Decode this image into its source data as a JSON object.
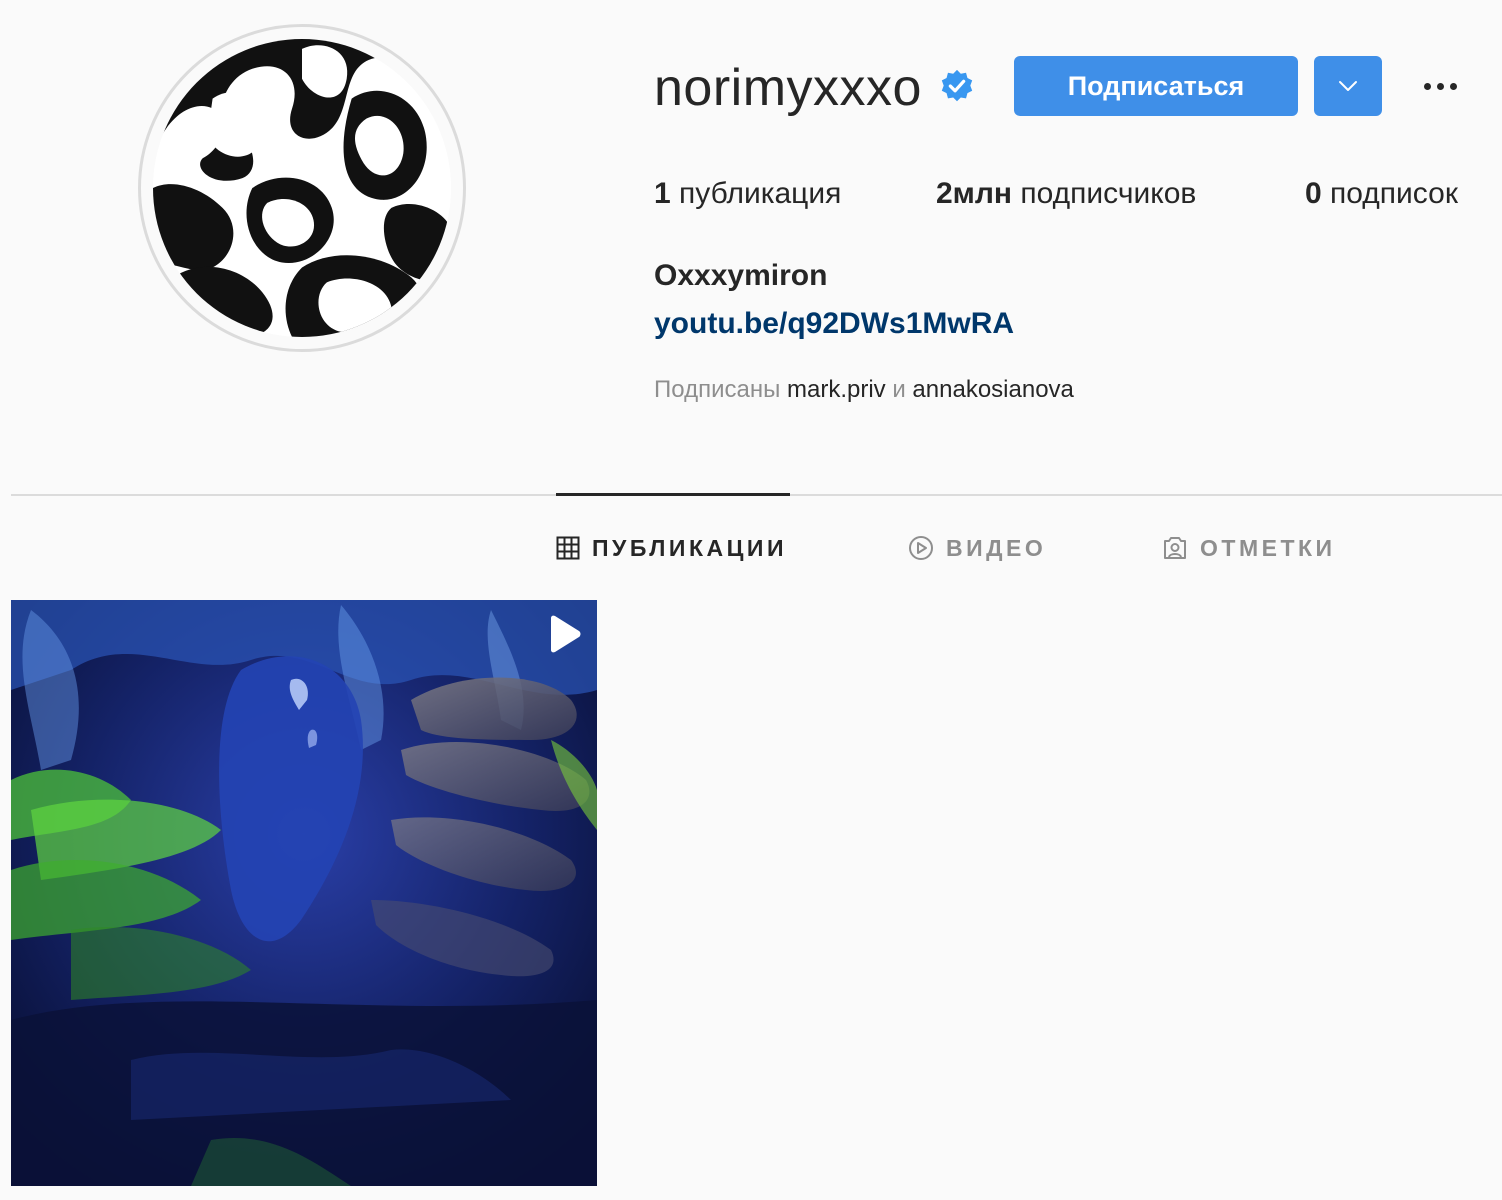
{
  "profile": {
    "username": "norimyxxxo",
    "verified": true,
    "full_name": "Oxxxymiron",
    "link": "youtu.be/q92DWs1MwRA"
  },
  "header": {
    "follow_label": "Подписаться",
    "dropdown_icon": "chevron-down-icon",
    "more_icon": "more-options-icon"
  },
  "stats": {
    "posts_count": "1",
    "posts_label": "публикация",
    "followers_count": "2млн",
    "followers_label": "подписчиков",
    "following_count": "0",
    "following_label": "подписок"
  },
  "followed_by": {
    "prefix": "Подписаны",
    "user1": "mark.priv",
    "conjunction": "и",
    "user2": "annakosianova"
  },
  "tabs": [
    {
      "label": "ПУБЛИКАЦИИ",
      "icon": "grid-icon",
      "active": true
    },
    {
      "label": "ВИДЕО",
      "icon": "play-circle-icon",
      "active": false
    },
    {
      "label": "ОТМЕТКИ",
      "icon": "tagged-user-icon",
      "active": false
    }
  ],
  "posts": [
    {
      "type": "video",
      "icon": "play-icon"
    }
  ],
  "colors": {
    "accent": "#3f8fe8",
    "link": "#00376b",
    "text": "#262626",
    "muted": "#8e8e8e",
    "background": "#fafafa"
  }
}
